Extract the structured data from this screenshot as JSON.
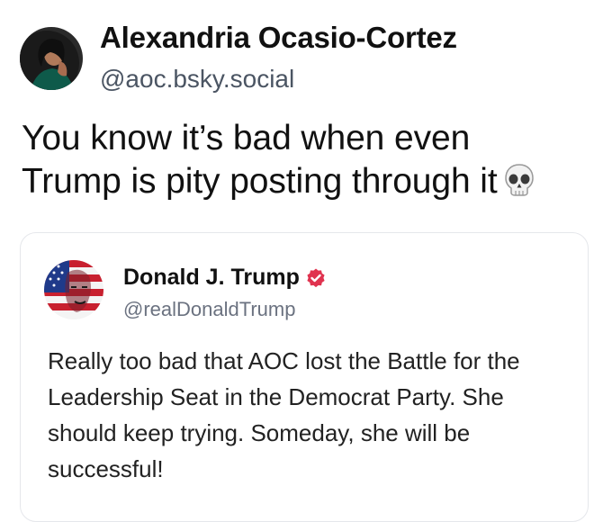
{
  "post": {
    "author_name": "Alexandria Ocasio-Cortez",
    "author_handle": "@aoc.bsky.social",
    "text_line1": "You know it’s bad when even",
    "text_line2": "Trump is pity posting through it",
    "emoji": "skull-emoji-icon"
  },
  "quoted_post": {
    "author_name": "Donald J. Trump",
    "author_handle": "@realDonaldTrump",
    "verified_icon": "verified-badge-icon",
    "text": "Really too bad that AOC lost the Battle for the Leadership Seat in the Democrat Party. She should keep trying. Someday, she will be successful!"
  },
  "colors": {
    "text_primary": "#111111",
    "handle_gray": "#4b5563",
    "card_border": "#e5e7eb",
    "verified_red": "#e0334f"
  }
}
